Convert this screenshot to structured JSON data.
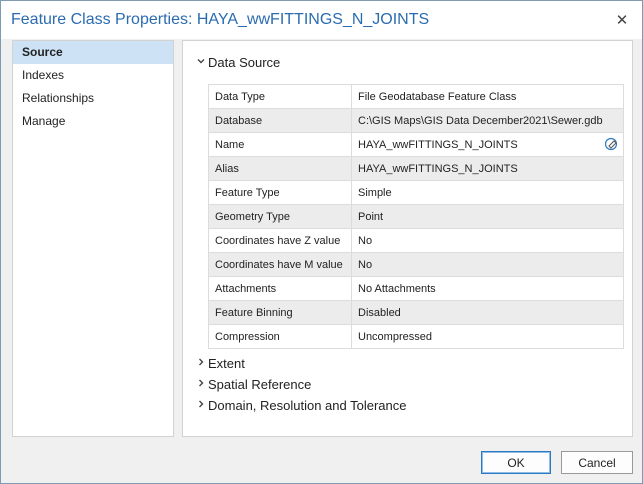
{
  "window": {
    "title": "Feature Class Properties: HAYA_wwFITTINGS_N_JOINTS",
    "close_glyph": "✕"
  },
  "sidebar": {
    "items": [
      {
        "label": "Source"
      },
      {
        "label": "Indexes"
      },
      {
        "label": "Relationships"
      },
      {
        "label": "Manage"
      }
    ]
  },
  "data_source": {
    "heading": "Data Source",
    "expanded": true,
    "rows": [
      {
        "key": "Data Type",
        "value": "File Geodatabase Feature Class"
      },
      {
        "key": "Database",
        "value": "C:\\GIS Maps\\GIS Data December2021\\Sewer.gdb"
      },
      {
        "key": "Name",
        "value": "HAYA_wwFITTINGS_N_JOINTS"
      },
      {
        "key": "Alias",
        "value": "HAYA_wwFITTINGS_N_JOINTS"
      },
      {
        "key": "Feature Type",
        "value": "Simple"
      },
      {
        "key": "Geometry Type",
        "value": "Point"
      },
      {
        "key": "Coordinates have Z value",
        "value": "No"
      },
      {
        "key": "Coordinates have M value",
        "value": "No"
      },
      {
        "key": "Attachments",
        "value": "No Attachments"
      },
      {
        "key": "Feature Binning",
        "value": "Disabled"
      },
      {
        "key": "Compression",
        "value": "Uncompressed"
      }
    ]
  },
  "collapsed_sections": [
    {
      "label": "Extent"
    },
    {
      "label": "Spatial Reference"
    },
    {
      "label": "Domain, Resolution and Tolerance"
    }
  ],
  "buttons": {
    "ok": "OK",
    "cancel": "Cancel"
  },
  "colors": {
    "title": "#2b6cb0",
    "selected_nav": "#cde3f5",
    "ok_border": "#2b79c2"
  }
}
